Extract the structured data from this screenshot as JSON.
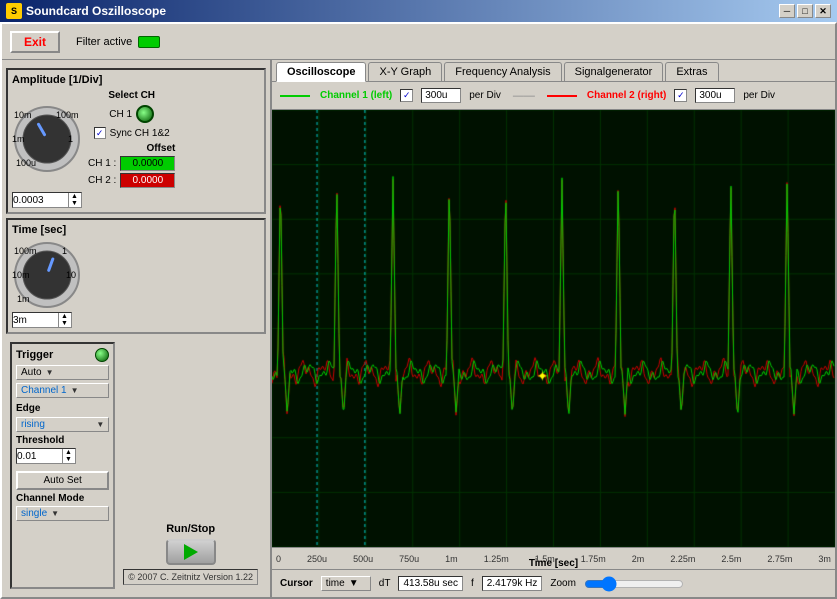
{
  "window": {
    "title": "Soundcard Oszilloscope",
    "icon": "S"
  },
  "titlebar": {
    "minimize": "─",
    "maximize": "□",
    "close": "✕"
  },
  "toolbar": {
    "exit_label": "Exit",
    "filter_label": "Filter active"
  },
  "tabs": [
    {
      "label": "Oscilloscope",
      "active": true
    },
    {
      "label": "X-Y Graph",
      "active": false
    },
    {
      "label": "Frequency Analysis",
      "active": false
    },
    {
      "label": "Signalgenerator",
      "active": false
    },
    {
      "label": "Extras",
      "active": false
    }
  ],
  "channels": {
    "ch1": {
      "label": "Channel 1 (left)",
      "checked": true,
      "time_div": "300u",
      "per_div": "per Div"
    },
    "ch2": {
      "label": "Channel 2 (right)",
      "checked": true,
      "time_div": "300u",
      "per_div": "per Div"
    }
  },
  "amplitude": {
    "title": "Amplitude [1/Div]",
    "labels": {
      "tl": "10m",
      "tr": "100m",
      "ml": "1m",
      "mr": "1",
      "bl": "100u"
    },
    "spinbox_value": "0.0003",
    "select_ch_label": "Select CH",
    "ch1_label": "CH 1"
  },
  "sync": {
    "label": "Sync CH 1&2",
    "checked": true
  },
  "offset": {
    "title": "Offset",
    "ch1_label": "CH 1 :",
    "ch2_label": "CH 2 :",
    "ch1_value": "0.0000",
    "ch2_value": "0.0000"
  },
  "time": {
    "title": "Time [sec]",
    "labels": {
      "tl": "100m",
      "tr": "1",
      "ml": "10m",
      "mr": "10",
      "bl": "1m"
    },
    "spinbox_value": "3m"
  },
  "trigger": {
    "title": "Trigger",
    "mode_label": "Auto",
    "channel_label": "Channel 1",
    "edge_label": "Edge",
    "edge_value": "rising",
    "threshold_label": "Threshold",
    "threshold_value": "0.01",
    "auto_set_label": "Auto Set"
  },
  "channel_mode": {
    "title": "Channel Mode",
    "value": "single"
  },
  "run_stop": {
    "label": "Run/Stop"
  },
  "copyright": {
    "text": "© 2007  C. Zeitnitz  Version 1.22"
  },
  "time_axis": {
    "labels": [
      "0",
      "250u",
      "500u",
      "750u",
      "1m",
      "1.25m",
      "1.5m",
      "1.75m",
      "2m",
      "2.25m",
      "2.5m",
      "2.75m",
      "3m"
    ],
    "unit": "Time [sec]"
  },
  "cursor": {
    "label": "Cursor",
    "type": "time",
    "dt_label": "dT",
    "dt_value": "413.58u",
    "dt_unit": "sec",
    "f_label": "f",
    "f_value": "2.4179k",
    "f_unit": "Hz",
    "zoom_label": "Zoom"
  }
}
